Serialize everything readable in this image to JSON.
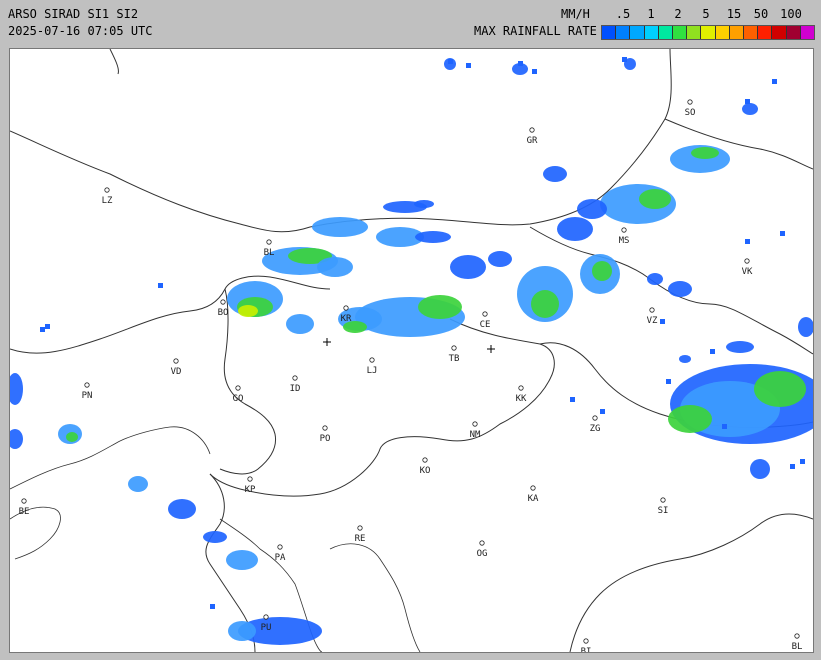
{
  "header": {
    "line1": "ARSO SIRAD SI1 SI2",
    "line2": "2025-07-16 07:05 UTC",
    "units": "MM/H",
    "rate_title": "MAX RAINFALL RATE"
  },
  "scale": {
    "labels": [
      ".5",
      "1",
      "2",
      "5",
      "15",
      "50",
      "100"
    ],
    "colors": [
      "#0050ff",
      "#0080ff",
      "#00a8ff",
      "#00d0ff",
      "#00e8a0",
      "#30e040",
      "#90e020",
      "#e0f000",
      "#ffd000",
      "#ffa000",
      "#ff6000",
      "#ff2000",
      "#d00000",
      "#a00030",
      "#d000d0"
    ]
  },
  "places": [
    "SO",
    "GR",
    "LZ",
    "BL",
    "VK",
    "MS",
    "BO",
    "KR",
    "CE",
    "VZ",
    "VD",
    "PN",
    "GO",
    "ID",
    "LJ",
    "TB",
    "KK",
    "PO",
    "NM",
    "ZG",
    "KO",
    "KP",
    "KA",
    "SI",
    "BE",
    "RE",
    "PA",
    "OG",
    "PU",
    "BI",
    "BL"
  ],
  "radar_colors": {
    "light": "#1e64ff",
    "medium": "#3c9bff",
    "heavy": "#3cd23c",
    "intense": "#c8f000"
  }
}
